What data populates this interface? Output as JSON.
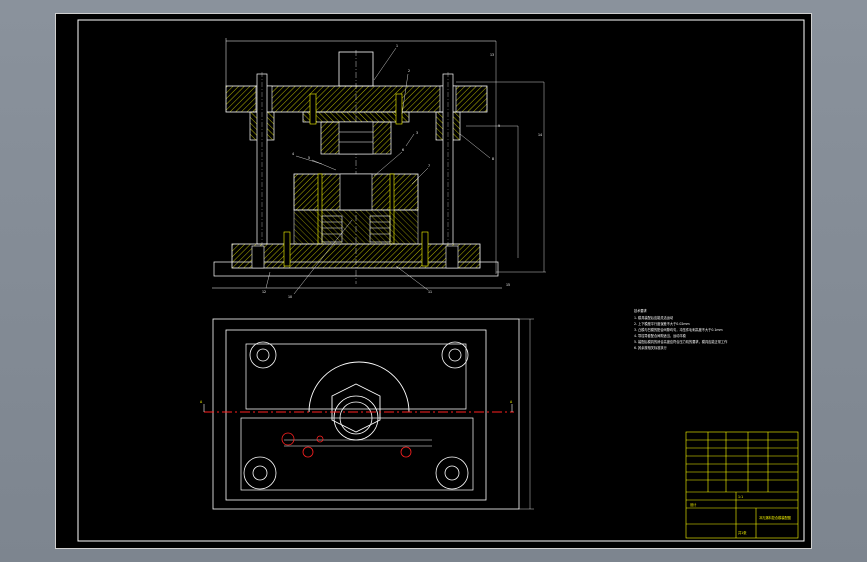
{
  "drawing": {
    "colors": {
      "background": "#000000",
      "frame": "#ffffff",
      "part_lines": "#ffffff",
      "hatch": "#ffff00",
      "dimension_lines": "#ffffff",
      "section_line": "#ff2020",
      "title_block": "#ffff00",
      "workspace": "#8a929c"
    },
    "leader_labels": {
      "part_1": "1",
      "part_2": "2",
      "part_3": "3",
      "part_4": "4",
      "part_5": "5",
      "part_6": "6",
      "part_7": "7",
      "part_8": "8",
      "part_9": "9",
      "part_10": "10",
      "part_11": "11",
      "part_12": "12",
      "part_13": "13",
      "part_14": "14",
      "part_15": "15"
    },
    "section_markers": {
      "left": "A",
      "right": "A"
    },
    "technical_notes": [
      "技术要求",
      "1. 模具装配后应能灵活运动",
      "2. 上下模座平行度误差不大于0.02mm",
      "3. 凸模与凹模的配合间隙均匀，冲压件毛刺高度不大于0.1mm",
      "4. 导柱导套配合间隙适当，运动平稳",
      "5. 装配后模具的闭合高度应符合压力机的要求，模具应能正常工作",
      "6. 其余按相关标准执行"
    ],
    "title_block": {
      "drawing_title": "冲孔落料复合模装配图",
      "school": "设计",
      "scale": "1:1",
      "sheet": "共1张"
    }
  }
}
